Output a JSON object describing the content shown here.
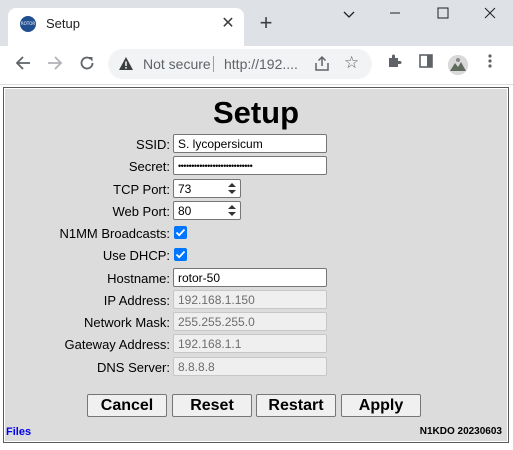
{
  "browser": {
    "tab_title": "Setup",
    "favicon_text": "ROTOR",
    "new_tab": "+",
    "not_secure": "Not secure",
    "url": "http://192....",
    "minimize": "⌄",
    "icons": [
      "back-arrow-icon",
      "forward-arrow-icon",
      "reload-icon",
      "warning-icon",
      "share-icon",
      "star-icon",
      "extensions-icon",
      "side-panel-icon",
      "profile-avatar",
      "kebab-menu-icon"
    ]
  },
  "page": {
    "title": "Setup",
    "fields": {
      "ssid": {
        "label": "SSID:",
        "value": "S. lycopersicum"
      },
      "secret": {
        "label": "Secret:",
        "value": "••••••••••••••••••••••••••••"
      },
      "tcp_port": {
        "label": "TCP Port:",
        "value": "73"
      },
      "web_port": {
        "label": "Web Port:",
        "value": "80"
      },
      "n1mm": {
        "label": "N1MM Broadcasts:",
        "checked": true
      },
      "dhcp": {
        "label": "Use DHCP:",
        "checked": true
      },
      "hostname": {
        "label": "Hostname:",
        "value": "rotor-50"
      },
      "ip": {
        "label": "IP Address:",
        "value": "192.168.1.150"
      },
      "mask": {
        "label": "Network Mask:",
        "value": "255.255.255.0"
      },
      "gateway": {
        "label": "Gateway Address:",
        "value": "192.168.1.1"
      },
      "dns": {
        "label": "DNS Server:",
        "value": "8.8.8.8"
      }
    },
    "buttons": {
      "cancel": "Cancel",
      "reset": "Reset",
      "restart": "Restart",
      "apply": "Apply"
    },
    "footer": {
      "files": "Files",
      "version": "N1KDO 20230603"
    }
  },
  "colors": {
    "checkbox": "#0075ff",
    "frame_bg": "#dcdcdc",
    "link": "#0000ee"
  }
}
